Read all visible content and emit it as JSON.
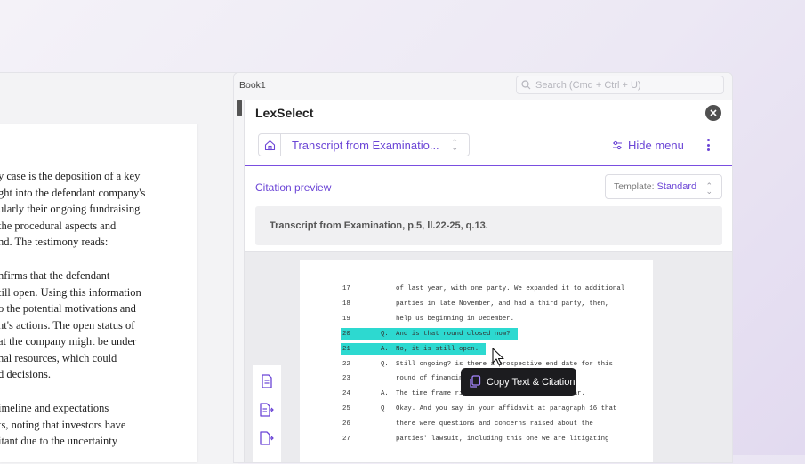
{
  "document": {
    "paragraphs": [
      [
        "y case is the deposition of a key",
        "ght into the defendant company's",
        "ularly their ongoing fundraising",
        "the procedural aspects and",
        "nd. The testimony reads:"
      ],
      [
        "nfirms that the defendant",
        "till open. Using this information",
        "o the potential motivations and",
        "nt's actions. The open status of",
        "at the company might be under",
        "nal resources, which could",
        "d decisions."
      ],
      [
        "imeline and expectations",
        "ts, noting that investors have",
        "itant due to the uncertainty"
      ]
    ]
  },
  "window": {
    "title": "Book1",
    "search_placeholder": "Search (Cmd + Ctrl + U)"
  },
  "panel": {
    "title": "LexSelect",
    "document_select": "Transcript from Examinatio...",
    "hide_menu": "Hide menu",
    "citation_preview_label": "Citation preview",
    "template_label": "Template:",
    "template_value": "Standard",
    "citation_text": "Transcript from Examination, p.5, ll.22-25, q.13."
  },
  "transcript": {
    "lines": [
      {
        "num": "17",
        "qa": "",
        "text": "of last year, with one party. We expanded it to additional",
        "highlight": false
      },
      {
        "num": "18",
        "qa": "",
        "text": "parties in late November, and had a third party, then,",
        "highlight": false
      },
      {
        "num": "19",
        "qa": "",
        "text": "help us beginning in December.",
        "highlight": false
      },
      {
        "num": "20",
        "qa": "Q.",
        "text": "And is that round closed now?",
        "highlight": true
      },
      {
        "num": "21",
        "qa": "A.",
        "text": "No, it is still open.",
        "highlight": true
      },
      {
        "num": "22",
        "qa": "Q.",
        "text": "Still ongoing? is there a prospective end date for this",
        "highlight": false
      },
      {
        "num": "23",
        "qa": "",
        "text": "round of financing?",
        "highlight": false
      },
      {
        "num": "24",
        "qa": "A.",
        "text": "The time frame right now is the end of the year.",
        "highlight": false
      },
      {
        "num": "25",
        "qa": "Q",
        "text": "Okay. And you say in your affidavit at paragraph 16 that",
        "highlight": false
      },
      {
        "num": "26",
        "qa": "",
        "text": "there were questions and concerns raised about the",
        "highlight": false
      },
      {
        "num": "27",
        "qa": "",
        "text": "parties' lawsuit, including this one we are litigating",
        "highlight": false
      }
    ]
  },
  "tooltip": {
    "label": "Copy Text & Citation"
  },
  "colors": {
    "accent": "#6b45d6",
    "highlight": "#2dd9d0",
    "tooltip_bg": "#1c1c1f"
  },
  "icons": [
    "search-icon",
    "home-icon",
    "filter-icon",
    "kebab-icon",
    "close-icon",
    "document-icon",
    "document-arrow-icon",
    "document-export-icon",
    "copy-icon",
    "cursor-icon"
  ]
}
